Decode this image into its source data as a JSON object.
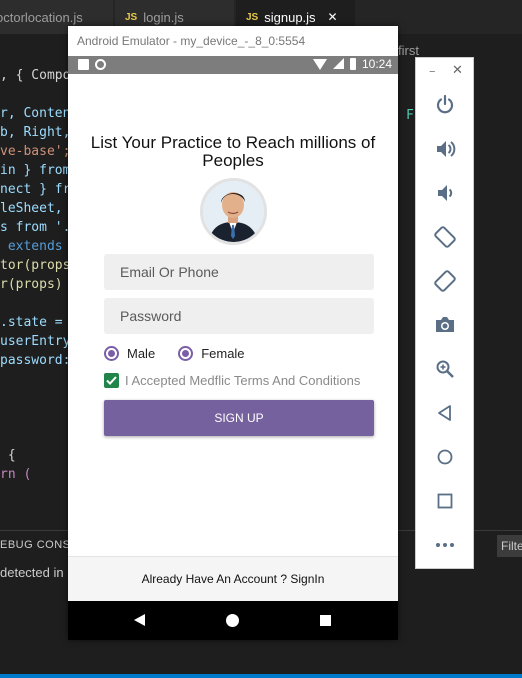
{
  "editor": {
    "tabs": [
      {
        "label": "octorlocation.js",
        "prefix": ""
      },
      {
        "label": "login.js",
        "prefix": "JS"
      },
      {
        "label": "signup.js",
        "prefix": "JS"
      }
    ],
    "close_glyph": "✕",
    "first_label": "first",
    "f_char": "F",
    "code_lines": [
      ", { Compo",
      "r, Conten",
      "b, Right,",
      "ve-base';",
      "in } from",
      "nect } fr",
      "leSheet,",
      "s from '.",
      " extends",
      "tor(props",
      "r(props)",
      "",
      ".state =",
      "userEntry",
      "password:",
      "",
      "",
      "",
      " {",
      "rn ("
    ],
    "panel_title": "EBUG CONSO",
    "panel_text": "detected in",
    "filter_text": "Filte"
  },
  "emulator": {
    "title": "Android Emulator - my_device_-_8_0:5554",
    "status_time": "10:24"
  },
  "app": {
    "heading": "List Your Practice to Reach millions of Peoples",
    "email_placeholder": "Email Or Phone",
    "password_placeholder": "Password",
    "gender_options": [
      "Male",
      "Female"
    ],
    "terms_label": "I Accepted Medflic Terms And Conditions",
    "signup_label": "SIGN UP",
    "footer_text": "Already Have An Account ? SignIn"
  },
  "toolbar": {
    "minimize": "–",
    "close": "✕",
    "buttons": [
      "power-icon",
      "volume-up-icon",
      "volume-down-icon",
      "rotate-left-icon",
      "rotate-right-icon",
      "camera-icon",
      "zoom-icon",
      "back-icon",
      "home-icon",
      "overview-icon",
      "more-icon"
    ]
  },
  "colors": {
    "accent": "#76619f",
    "checkbox": "#21854a",
    "vscode_bg": "#1e1e1e",
    "statusbar": "#007acc"
  }
}
